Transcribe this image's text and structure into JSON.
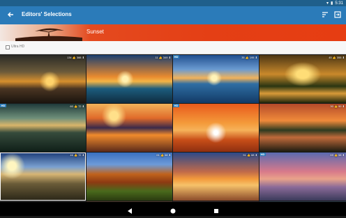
{
  "status": {
    "time": "5:31"
  },
  "appbar": {
    "title": "Editors' Selections",
    "back_icon": "arrow-back-icon",
    "sort_icon": "sort-icon",
    "import_icon": "import-icon"
  },
  "banner": {
    "label": "Sunset",
    "accent": "#e43f15"
  },
  "filter": {
    "label": "Ultra HD",
    "checked": false
  },
  "tiles": [
    {
      "meta": "134 👍 388 ⬇",
      "hd": false,
      "theme": "wave"
    },
    {
      "meta": "11 👍 349 ⬇",
      "hd": false,
      "theme": "palm"
    },
    {
      "meta": "35 👍 195 ⬇",
      "hd": true,
      "theme": "sea"
    },
    {
      "meta": "45 👍 355 ⬇",
      "hd": false,
      "theme": "tree"
    },
    {
      "meta": "60 👍 72 ⬇",
      "hd": true,
      "theme": "lake"
    },
    {
      "meta": "",
      "hd": false,
      "theme": "mountain"
    },
    {
      "meta": "",
      "hd": true,
      "theme": "dolphin"
    },
    {
      "meta": "30 👍 90 ⬇",
      "hd": false,
      "theme": "forest"
    },
    {
      "meta": "46 👍 72 ⬇",
      "hd": false,
      "theme": "canyon"
    },
    {
      "meta": "61 👍 68 ⬇",
      "hd": false,
      "theme": "autumn"
    },
    {
      "meta": "51 👍 68 ⬇",
      "hd": false,
      "theme": "balloon"
    },
    {
      "meta": "69 👍 58 ⬇",
      "hd": true,
      "theme": "rock"
    }
  ]
}
